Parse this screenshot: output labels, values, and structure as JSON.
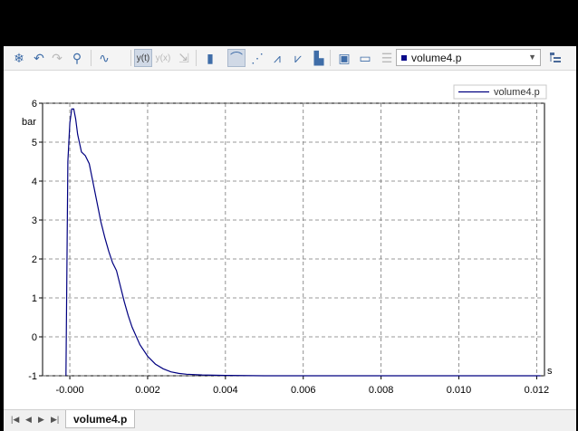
{
  "toolbar": {
    "buttons": [
      {
        "name": "freeze-button",
        "icon": "snowflake-icon",
        "glyph": "❄",
        "state": "normal"
      },
      {
        "name": "undo-button",
        "icon": "undo-icon",
        "glyph": "↶",
        "state": "normal"
      },
      {
        "name": "redo-button",
        "icon": "redo-icon",
        "glyph": "↷",
        "state": "disabled"
      },
      {
        "name": "zoom-button",
        "icon": "magnifier-icon",
        "glyph": "⚲",
        "state": "normal"
      },
      {
        "name": "plot-type-button",
        "icon": "curve-icon",
        "glyph": "∿",
        "state": "normal"
      },
      {
        "name": "yt-mode-button",
        "icon": "yt-icon",
        "label": "y(t)",
        "state": "active"
      },
      {
        "name": "yx-mode-button",
        "icon": "yx-icon",
        "label": "y(x)",
        "state": "disabled"
      },
      {
        "name": "export-button",
        "icon": "export-icon",
        "glyph": "⇲",
        "state": "disabled"
      },
      {
        "name": "bar-view-button",
        "icon": "bar-chart-icon",
        "glyph": "▮",
        "state": "normal"
      },
      {
        "name": "line-view-button",
        "icon": "line-chart-icon",
        "glyph": "⌒",
        "state": "active"
      },
      {
        "name": "dashed-view-button",
        "icon": "dashed-chart-icon",
        "glyph": "⋰",
        "state": "normal"
      },
      {
        "name": "multi-view-button",
        "icon": "multi-chart-icon",
        "glyph": "⩘",
        "state": "normal"
      },
      {
        "name": "overlay-view-button",
        "icon": "overlay-chart-icon",
        "glyph": "⩗",
        "state": "normal"
      },
      {
        "name": "histogram-button",
        "icon": "histogram-icon",
        "glyph": "▙",
        "state": "normal"
      },
      {
        "name": "image-export-button",
        "icon": "image-icon",
        "glyph": "▣",
        "state": "normal"
      },
      {
        "name": "ruler-button",
        "icon": "ruler-icon",
        "glyph": "▭",
        "state": "normal"
      },
      {
        "name": "list-button",
        "icon": "list-icon",
        "glyph": "☰",
        "state": "disabled"
      }
    ],
    "series_select": {
      "value": "volume4.p"
    },
    "settings_icon": "tree-icon"
  },
  "legend": {
    "label": "volume4.p"
  },
  "statusbar": {
    "sheet_tab": "volume4.p"
  },
  "chart_data": {
    "type": "line",
    "xlabel": "s",
    "ylabel": "bar",
    "xlim": [
      -0.0007,
      0.0122
    ],
    "ylim": [
      -1,
      6
    ],
    "x_ticks": [
      "-0.000",
      "0.002",
      "0.004",
      "0.006",
      "0.008",
      "0.010",
      "0.012"
    ],
    "y_ticks": [
      "-1",
      "0",
      "1",
      "2",
      "3",
      "4",
      "5",
      "6"
    ],
    "grid": true,
    "legend_position": "top-right",
    "series": [
      {
        "name": "volume4.p",
        "color": "#000080",
        "x": [
          -0.0001,
          -5e-05,
          0,
          5e-05,
          0.0001,
          0.00015,
          0.0002,
          0.0003,
          0.0004,
          0.0005,
          0.0006,
          0.0007,
          0.0008,
          0.0009,
          0.001,
          0.0011,
          0.0012,
          0.0013,
          0.0014,
          0.0015,
          0.0016,
          0.0018,
          0.002,
          0.0022,
          0.0024,
          0.0026,
          0.0028,
          0.003,
          0.0034,
          0.004,
          0.005,
          0.006,
          0.008,
          0.01,
          0.0121
        ],
        "y": [
          -1,
          4.5,
          5.5,
          5.85,
          5.85,
          5.6,
          5.2,
          4.75,
          4.65,
          4.45,
          3.95,
          3.45,
          2.95,
          2.55,
          2.2,
          1.9,
          1.7,
          1.3,
          0.9,
          0.55,
          0.25,
          -0.2,
          -0.5,
          -0.7,
          -0.82,
          -0.9,
          -0.94,
          -0.96,
          -0.98,
          -0.99,
          -1.0,
          -1.0,
          -1.0,
          -1.0,
          -1.0
        ]
      }
    ]
  }
}
